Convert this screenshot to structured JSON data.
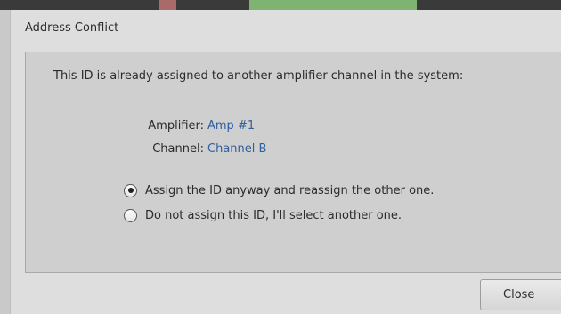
{
  "dialog": {
    "title": "Address Conflict",
    "message": "This ID is already assigned to another amplifier channel in the system:",
    "amplifier_label": "Amplifier:",
    "amplifier_value": "Amp #1",
    "channel_label": "Channel:",
    "channel_value": "Channel B",
    "options": [
      {
        "label": "Assign the ID anyway and reassign the other one.",
        "checked": true
      },
      {
        "label": "Do not assign this ID, I'll select another one.",
        "checked": false
      }
    ],
    "close_label": "Close"
  },
  "colors": {
    "link_value": "#2f5f9e",
    "panel_bg": "#cfcfcf",
    "dialog_bg": "#dedede"
  }
}
